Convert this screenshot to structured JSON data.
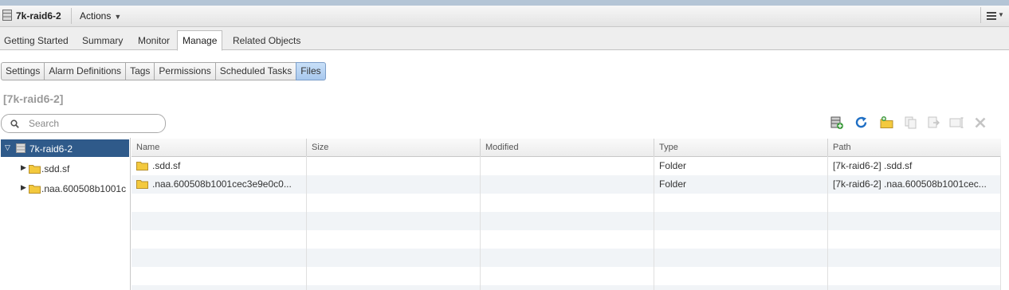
{
  "header": {
    "object_name": "7k-raid6-2",
    "actions_label": "Actions"
  },
  "tabs": [
    {
      "label": "Getting Started"
    },
    {
      "label": "Summary"
    },
    {
      "label": "Monitor"
    },
    {
      "label": "Manage",
      "active": true
    },
    {
      "label": "Related Objects"
    }
  ],
  "subtabs": [
    {
      "label": "Settings"
    },
    {
      "label": "Alarm Definitions"
    },
    {
      "label": "Tags"
    },
    {
      "label": "Permissions"
    },
    {
      "label": "Scheduled Tasks"
    },
    {
      "label": "Files",
      "selected": true
    }
  ],
  "page_title": "[7k-raid6-2]",
  "search": {
    "placeholder": "Search",
    "value": ""
  },
  "toolbar_icons": [
    "datastore-upload-icon",
    "refresh-icon",
    "new-folder-icon",
    "copy-icon",
    "move-icon",
    "rename-icon",
    "delete-icon"
  ],
  "tree": {
    "root": {
      "label": "7k-raid6-2",
      "icon": "datastore-icon"
    },
    "children": [
      {
        "label": ".sdd.sf",
        "icon": "folder-icon"
      },
      {
        "label": ".naa.600508b1001c",
        "icon": "folder-icon"
      }
    ]
  },
  "table": {
    "columns": [
      "Name",
      "Size",
      "Modified",
      "Type",
      "Path"
    ],
    "rows": [
      {
        "name": ".sdd.sf",
        "size": "",
        "modified": "",
        "type": "Folder",
        "path": "[7k-raid6-2] .sdd.sf"
      },
      {
        "name": ".naa.600508b1001cec3e9e0c0...",
        "size": "",
        "modified": "",
        "type": "Folder",
        "path": "[7k-raid6-2] .naa.600508b1001cec..."
      }
    ]
  },
  "colors": {
    "selected_tree_bg": "#2f5a8a",
    "selected_subtab_bg": "#a8c8ee",
    "alt_row": "#f1f4f7",
    "folder_yellow": "#f3c93e"
  }
}
